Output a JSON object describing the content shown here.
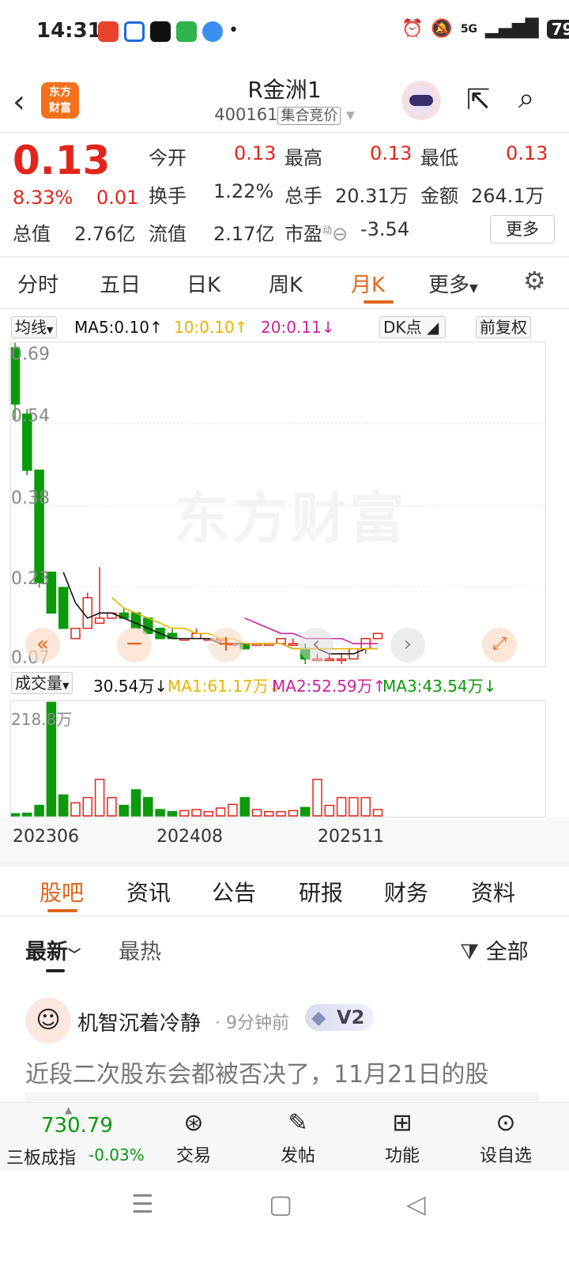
{
  "status": {
    "time": "14:31",
    "battery": "79",
    "network": "5G"
  },
  "header": {
    "title": "R金洲1",
    "code": "400161",
    "auction_tag": "集合竞价",
    "logo_text": "东方财富"
  },
  "quote": {
    "price": "0.13",
    "change_pct": "8.33%",
    "change": "0.01",
    "open_label": "今开",
    "open": "0.13",
    "high_label": "最高",
    "high": "0.13",
    "low_label": "最低",
    "low": "0.13",
    "turnover_label": "换手",
    "turnover": "1.22%",
    "volume_label": "总手",
    "volume": "20.31万",
    "amount_label": "金额",
    "amount": "264.1万",
    "mktcap_label": "总值",
    "mktcap": "2.76亿",
    "float_label": "流值",
    "float": "2.17亿",
    "pe_label": "市盈",
    "pe_sup": "动",
    "pe": "-3.54",
    "more": "更多"
  },
  "ktabs": [
    "分时",
    "五日",
    "日K",
    "周K",
    "月K",
    "更多"
  ],
  "ma": {
    "label": "均线",
    "ma5": "MA5:0.10",
    "ma10": "10:0.10",
    "ma20": "20:0.11",
    "dk": "DK点",
    "adj": "前复权"
  },
  "price_axis": [
    "0.69",
    "0.54",
    "0.38",
    "0.23",
    "0.07"
  ],
  "watermark": "东方财富",
  "vol": {
    "label": "成交量",
    "v": "30.54万",
    "ma1": "MA1:61.17万",
    "ma2": "MA2:52.59万",
    "ma3": "MA3:43.54万",
    "axis_top": "218.8万"
  },
  "dates": [
    "202306",
    "202408",
    "202511"
  ],
  "colors": {
    "up": "#e1251b",
    "down": "#0a9a0a",
    "accent": "#e1651b",
    "ma5": "#111111",
    "ma10": "#e8b400",
    "ma20": "#cc2299",
    "vma3": "#0a9a0a"
  },
  "news_tabs": [
    "股吧",
    "资讯",
    "公告",
    "研报",
    "财务",
    "资料"
  ],
  "sort": {
    "latest": "最新",
    "hot": "最热",
    "all": "全部"
  },
  "post": {
    "user": "机智沉着冷静",
    "time": "9分钟前",
    "level": "V2",
    "text": "近段二次股东会都被否决了，11月21日的股"
  },
  "bottom": {
    "index_value": "730.79",
    "index_name": "三板成指",
    "index_change": "-0.03%",
    "trade": "交易",
    "post": "发帖",
    "func": "功能",
    "watch": "设自选"
  },
  "chart_data": {
    "type": "candlestick",
    "x": [
      "2023-05",
      "2023-06",
      "2023-07",
      "2023-08",
      "2023-09",
      "2023-10",
      "2023-11",
      "2023-12",
      "2024-01",
      "2024-02",
      "2024-03",
      "2024-04",
      "2024-05",
      "2024-06",
      "2024-07",
      "2024-08",
      "2024-09",
      "2024-10",
      "2024-11",
      "2024-12",
      "2025-01",
      "2025-02",
      "2025-03",
      "2025-04",
      "2025-05",
      "2025-06",
      "2025-07",
      "2025-08",
      "2025-09",
      "2025-10",
      "2025-11"
    ],
    "open": [
      0.69,
      0.56,
      0.45,
      0.25,
      0.22,
      0.12,
      0.14,
      0.15,
      0.16,
      0.17,
      0.17,
      0.16,
      0.14,
      0.13,
      0.12,
      0.12,
      0.12,
      0.12,
      0.11,
      0.11,
      0.11,
      0.11,
      0.11,
      0.11,
      0.1,
      0.08,
      0.08,
      0.08,
      0.08,
      0.1,
      0.12
    ],
    "close": [
      0.58,
      0.45,
      0.23,
      0.17,
      0.14,
      0.14,
      0.2,
      0.16,
      0.17,
      0.16,
      0.14,
      0.13,
      0.12,
      0.12,
      0.12,
      0.13,
      0.12,
      0.12,
      0.11,
      0.1,
      0.11,
      0.11,
      0.12,
      0.11,
      0.08,
      0.08,
      0.08,
      0.08,
      0.1,
      0.12,
      0.13
    ],
    "high": [
      0.7,
      0.57,
      0.45,
      0.25,
      0.22,
      0.14,
      0.21,
      0.26,
      0.17,
      0.18,
      0.17,
      0.16,
      0.14,
      0.14,
      0.12,
      0.14,
      0.12,
      0.12,
      0.11,
      0.11,
      0.11,
      0.11,
      0.12,
      0.12,
      0.11,
      0.09,
      0.09,
      0.09,
      0.1,
      0.12,
      0.13
    ],
    "low": [
      0.55,
      0.44,
      0.22,
      0.17,
      0.14,
      0.12,
      0.14,
      0.15,
      0.16,
      0.16,
      0.14,
      0.13,
      0.12,
      0.12,
      0.12,
      0.12,
      0.12,
      0.11,
      0.11,
      0.1,
      0.11,
      0.11,
      0.11,
      0.11,
      0.07,
      0.08,
      0.08,
      0.07,
      0.08,
      0.09,
      0.12
    ],
    "volume": [
      4,
      5,
      20,
      218,
      40,
      25,
      35,
      70,
      35,
      20,
      50,
      35,
      12,
      8,
      10,
      12,
      8,
      15,
      22,
      35,
      12,
      8,
      8,
      10,
      16,
      70,
      20,
      35,
      35,
      35,
      12
    ],
    "ma5": [
      null,
      null,
      null,
      null,
      0.25,
      0.19,
      0.16,
      0.17,
      0.17,
      0.16,
      0.15,
      0.14,
      0.13,
      0.12,
      0.12,
      0.12,
      0.12,
      0.11,
      0.11,
      0.11,
      0.11,
      0.11,
      0.11,
      0.1,
      0.1,
      0.1,
      0.09,
      0.09,
      0.09,
      0.1,
      0.1
    ],
    "ma10": [
      null,
      null,
      null,
      null,
      null,
      null,
      null,
      null,
      0.2,
      0.18,
      0.17,
      0.16,
      0.15,
      0.14,
      0.14,
      0.13,
      0.13,
      0.12,
      0.12,
      0.11,
      0.11,
      0.11,
      0.11,
      0.1,
      0.1,
      0.1,
      0.1,
      0.1,
      0.1,
      0.1,
      0.1
    ],
    "ma20": [
      null,
      null,
      null,
      null,
      null,
      null,
      null,
      null,
      null,
      null,
      null,
      null,
      null,
      null,
      null,
      null,
      null,
      null,
      null,
      0.16,
      0.15,
      0.14,
      0.13,
      0.13,
      0.12,
      0.12,
      0.12,
      0.12,
      0.11,
      0.11,
      0.11
    ],
    "ylim": [
      0.07,
      0.69
    ],
    "vol_ylim": [
      0,
      218.8
    ]
  }
}
